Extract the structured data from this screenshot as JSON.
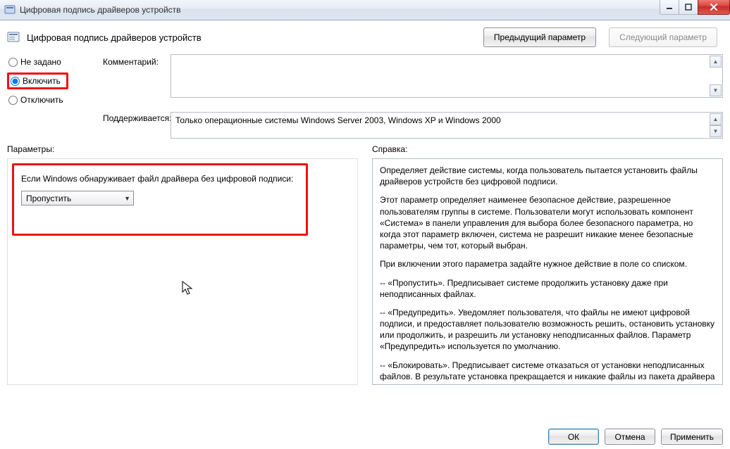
{
  "window": {
    "title": "Цифровая подпись драйверов устройств"
  },
  "header": {
    "title": "Цифровая подпись драйверов устройств",
    "prev_button": "Предыдущий параметр",
    "next_button": "Следующий параметр"
  },
  "radios": {
    "not_configured": "Не задано",
    "enabled": "Включить",
    "disabled": "Отключить",
    "selected": "enabled"
  },
  "labels": {
    "comment": "Комментарий:",
    "supported": "Поддерживается:",
    "parameters": "Параметры:",
    "help": "Справка:"
  },
  "supported_text": "Только операционные системы Windows Server 2003, Windows XP и Windows 2000",
  "params": {
    "prompt": "Если Windows обнаруживает файл драйвера без цифровой подписи:",
    "selected": "Пропустить"
  },
  "help_paragraphs": [
    "Определяет действие системы, когда пользователь пытается установить файлы драйверов устройств без цифровой подписи.",
    "Этот параметр определяет наименее безопасное действие, разрешенное пользователям группы в системе. Пользователи могут использовать компонент «Система» в панели управления для выбора более безопасного параметра, но когда этот параметр включен, система не разрешит никакие менее безопасные параметры, чем тот, который выбран.",
    "При включении этого параметра задайте нужное действие в поле со списком.",
    "--   «Пропустить». Предписывает системе продолжить установку даже при неподписанных файлах.",
    "--   «Предупредить». Уведомляет пользователя, что файлы не имеют цифровой подписи, и предоставляет пользователю возможность решить, остановить установку или продолжить, и разрешить ли установку неподписанных файлов. Параметр «Предупредить» используется по умолчанию.",
    "--   «Блокировать». Предписывает системе отказаться от установки неподписанных файлов. В результате установка прекращается и никакие файлы из пакета драйвера не устанавливаются."
  ],
  "buttons": {
    "ok": "ОК",
    "cancel": "Отмена",
    "apply": "Применить"
  }
}
